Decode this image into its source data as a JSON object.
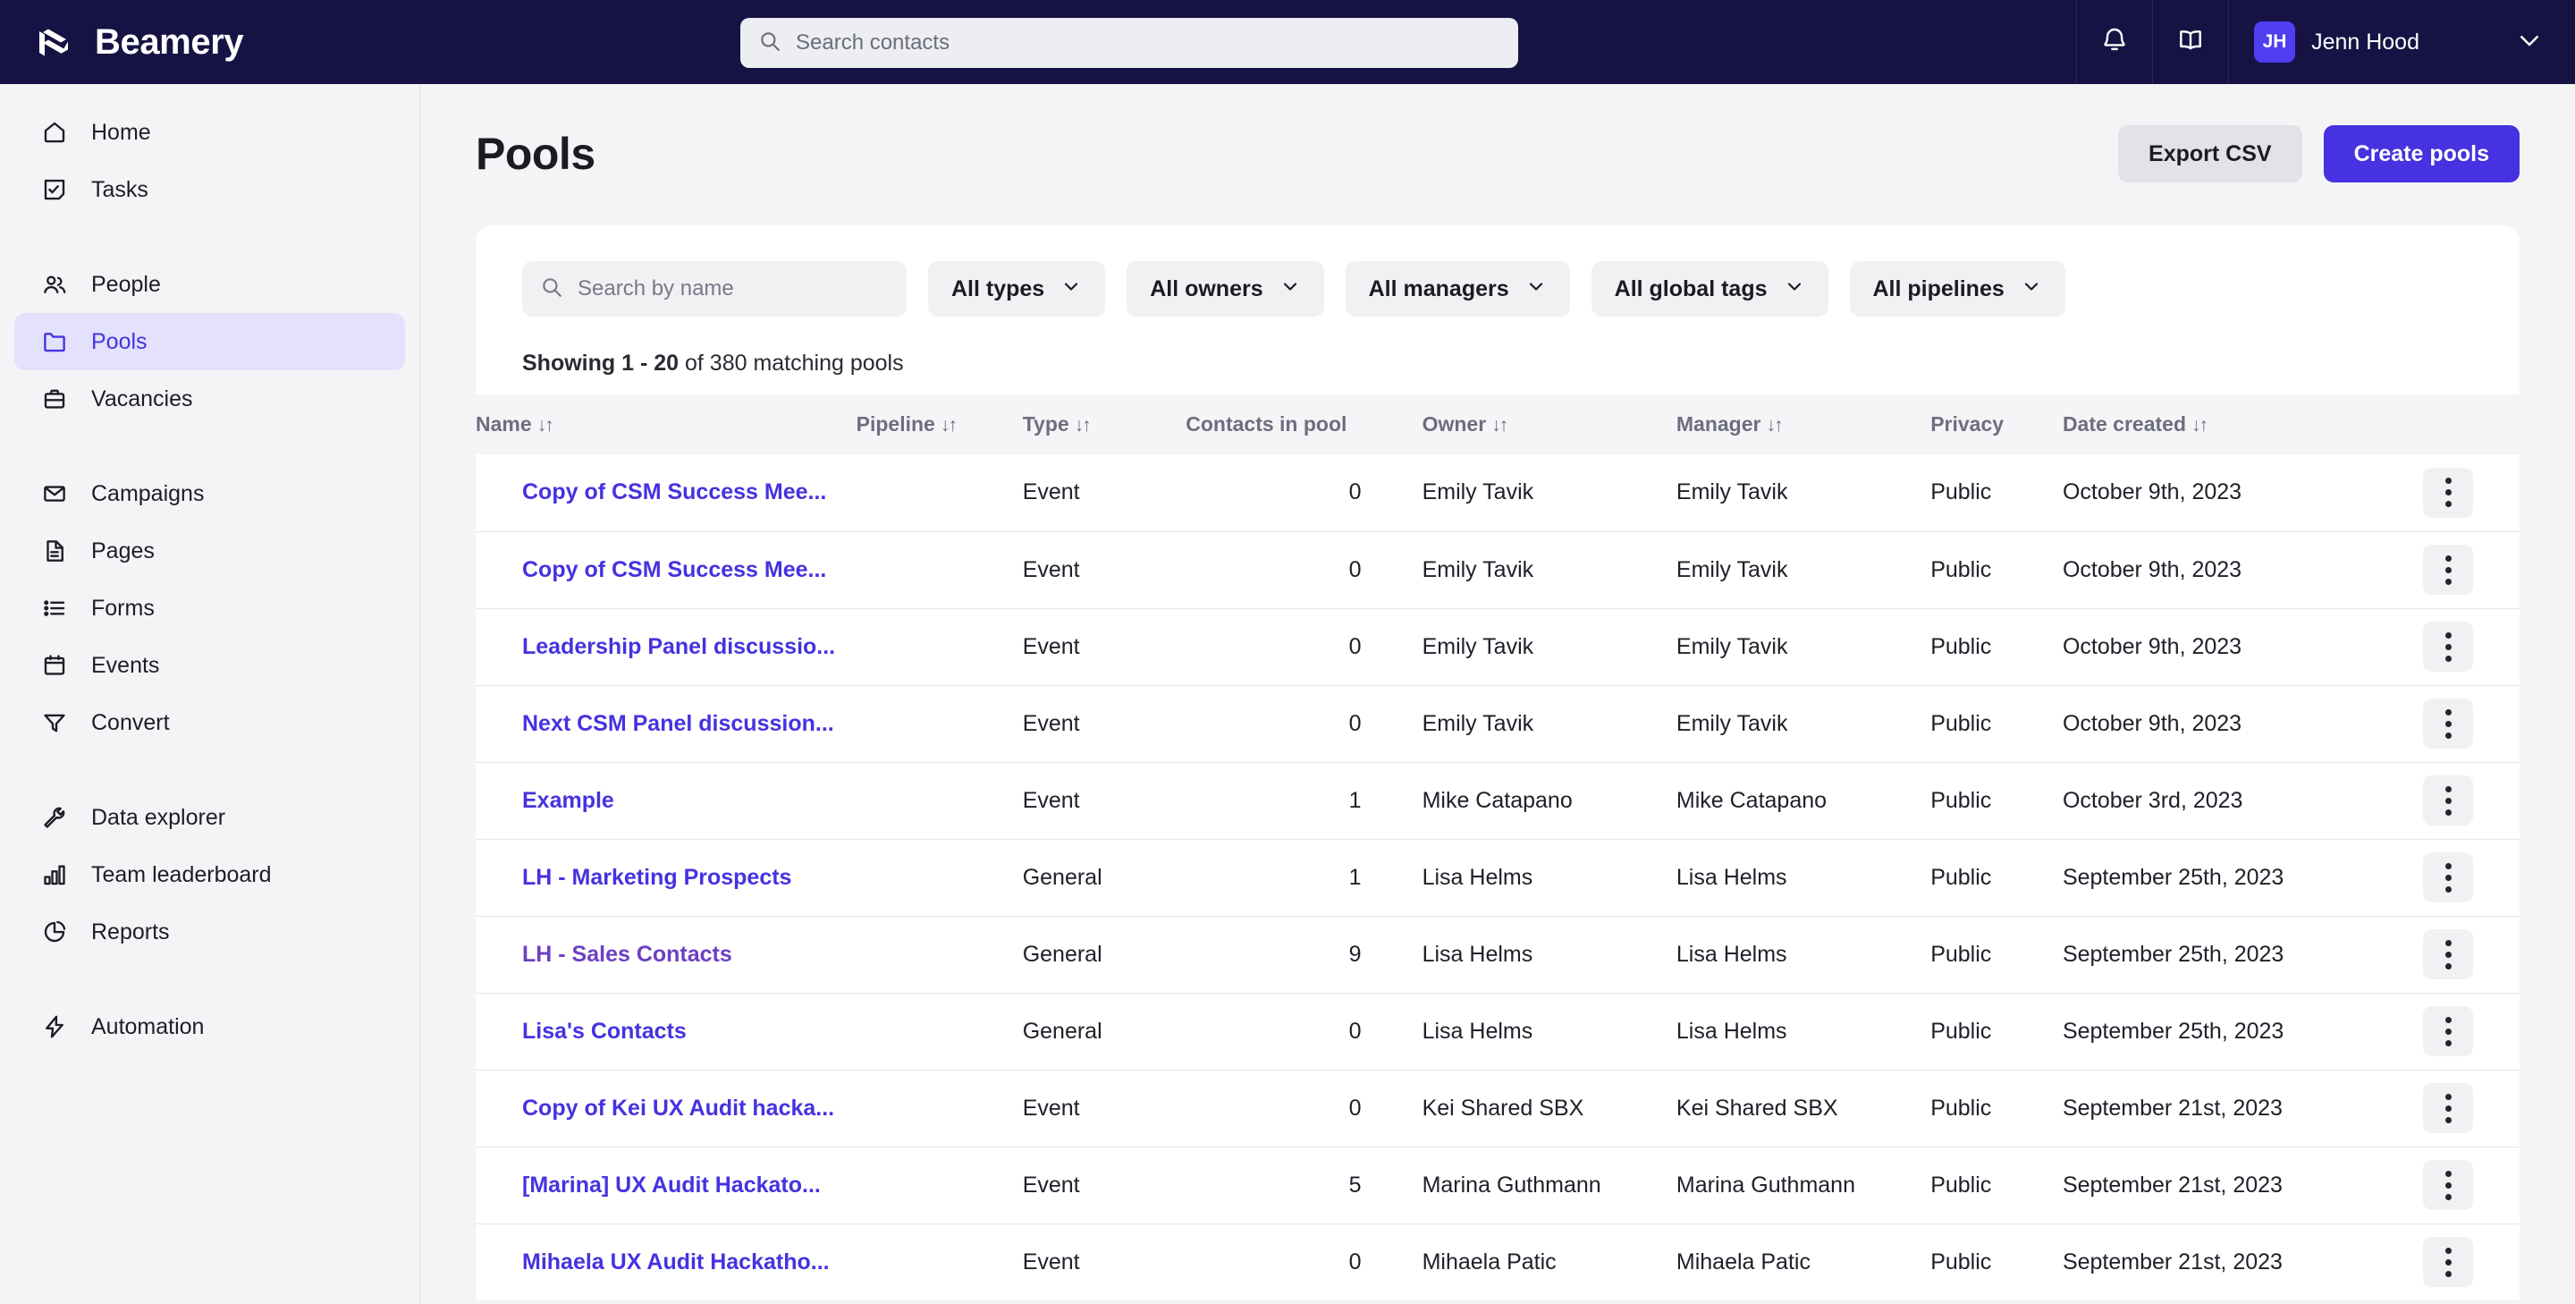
{
  "topbar": {
    "brand": "Beamery",
    "search_placeholder": "Search contacts",
    "notifications_icon": "bell-icon",
    "knowledge_icon": "book-icon",
    "user": {
      "initials": "JH",
      "name": "Jenn Hood"
    },
    "caret_icon": "chevron-down-icon"
  },
  "sidebar": {
    "groups": [
      {
        "items": [
          {
            "label": "Home",
            "icon": "home-icon",
            "active": false
          },
          {
            "label": "Tasks",
            "icon": "tasks-icon",
            "active": false
          }
        ]
      },
      {
        "items": [
          {
            "label": "People",
            "icon": "people-icon",
            "active": false
          },
          {
            "label": "Pools",
            "icon": "folder-icon",
            "active": true
          },
          {
            "label": "Vacancies",
            "icon": "briefcase-icon",
            "active": false
          }
        ]
      },
      {
        "items": [
          {
            "label": "Campaigns",
            "icon": "envelope-icon",
            "active": false
          },
          {
            "label": "Pages",
            "icon": "document-icon",
            "active": false
          },
          {
            "label": "Forms",
            "icon": "list-icon",
            "active": false
          },
          {
            "label": "Events",
            "icon": "calendar-icon",
            "active": false
          },
          {
            "label": "Convert",
            "icon": "funnel-icon",
            "active": false
          }
        ]
      },
      {
        "items": [
          {
            "label": "Data explorer",
            "icon": "wrench-icon",
            "active": false
          },
          {
            "label": "Team leaderboard",
            "icon": "bar-chart-icon",
            "active": false
          },
          {
            "label": "Reports",
            "icon": "pie-chart-icon",
            "active": false
          }
        ]
      },
      {
        "items": [
          {
            "label": "Automation",
            "icon": "bolt-icon",
            "active": false
          }
        ]
      }
    ]
  },
  "page": {
    "title": "Pools",
    "export_label": "Export CSV",
    "create_label": "Create pools"
  },
  "filters": {
    "search_placeholder": "Search by name",
    "chips": [
      {
        "label": "All types"
      },
      {
        "label": "All owners"
      },
      {
        "label": "All managers"
      },
      {
        "label": "All global tags"
      },
      {
        "label": "All pipelines"
      }
    ]
  },
  "results": {
    "showing_prefix": "Showing ",
    "range": "1 - 20",
    "showing_suffix": " of 380 matching pools"
  },
  "table": {
    "columns": [
      {
        "label": "Name",
        "sortable": true
      },
      {
        "label": "Pipeline",
        "sortable": true
      },
      {
        "label": "Type",
        "sortable": true
      },
      {
        "label": "Contacts in pool",
        "sortable": false
      },
      {
        "label": "Owner",
        "sortable": true
      },
      {
        "label": "Manager",
        "sortable": true
      },
      {
        "label": "Privacy",
        "sortable": false
      },
      {
        "label": "Date created",
        "sortable": true
      }
    ],
    "sort_glyph": "↓↑",
    "rows": [
      {
        "name": "Copy of CSM Success Mee...",
        "visited": false,
        "pipeline": "",
        "type": "Event",
        "contacts": "0",
        "owner": "Emily Tavik",
        "manager": "Emily Tavik",
        "privacy": "Public",
        "date": "October 9th, 2023"
      },
      {
        "name": "Copy of CSM Success Mee...",
        "visited": false,
        "pipeline": "",
        "type": "Event",
        "contacts": "0",
        "owner": "Emily Tavik",
        "manager": "Emily Tavik",
        "privacy": "Public",
        "date": "October 9th, 2023"
      },
      {
        "name": "Leadership Panel discussio...",
        "visited": false,
        "pipeline": "",
        "type": "Event",
        "contacts": "0",
        "owner": "Emily Tavik",
        "manager": "Emily Tavik",
        "privacy": "Public",
        "date": "October 9th, 2023"
      },
      {
        "name": "Next CSM Panel discussion...",
        "visited": false,
        "pipeline": "",
        "type": "Event",
        "contacts": "0",
        "owner": "Emily Tavik",
        "manager": "Emily Tavik",
        "privacy": "Public",
        "date": "October 9th, 2023"
      },
      {
        "name": "Example",
        "visited": false,
        "pipeline": "",
        "type": "Event",
        "contacts": "1",
        "owner": "Mike Catapano",
        "manager": "Mike Catapano",
        "privacy": "Public",
        "date": "October 3rd, 2023"
      },
      {
        "name": "LH - Marketing Prospects",
        "visited": false,
        "pipeline": "",
        "type": "General",
        "contacts": "1",
        "owner": "Lisa Helms",
        "manager": "Lisa Helms",
        "privacy": "Public",
        "date": "September 25th, 2023"
      },
      {
        "name": "LH - Sales Contacts",
        "visited": true,
        "pipeline": "",
        "type": "General",
        "contacts": "9",
        "owner": "Lisa Helms",
        "manager": "Lisa Helms",
        "privacy": "Public",
        "date": "September 25th, 2023"
      },
      {
        "name": "Lisa's Contacts",
        "visited": false,
        "pipeline": "",
        "type": "General",
        "contacts": "0",
        "owner": "Lisa Helms",
        "manager": "Lisa Helms",
        "privacy": "Public",
        "date": "September 25th, 2023"
      },
      {
        "name": "Copy of Kei UX Audit hacka...",
        "visited": false,
        "pipeline": "",
        "type": "Event",
        "contacts": "0",
        "owner": "Kei Shared SBX",
        "manager": "Kei Shared SBX",
        "privacy": "Public",
        "date": "September 21st, 2023"
      },
      {
        "name": "[Marina] UX Audit Hackato...",
        "visited": false,
        "pipeline": "",
        "type": "Event",
        "contacts": "5",
        "owner": "Marina Guthmann",
        "manager": "Marina Guthmann",
        "privacy": "Public",
        "date": "September 21st, 2023"
      },
      {
        "name": "Mihaela UX Audit Hackatho...",
        "visited": false,
        "pipeline": "",
        "type": "Event",
        "contacts": "0",
        "owner": "Mihaela Patic",
        "manager": "Mihaela Patic",
        "privacy": "Public",
        "date": "September 21st, 2023"
      }
    ],
    "row_menu_icon": "kebab-menu-icon"
  },
  "colors": {
    "nav_bg": "#161344",
    "accent": "#4632e0",
    "active_bg": "#e3e1fb"
  }
}
